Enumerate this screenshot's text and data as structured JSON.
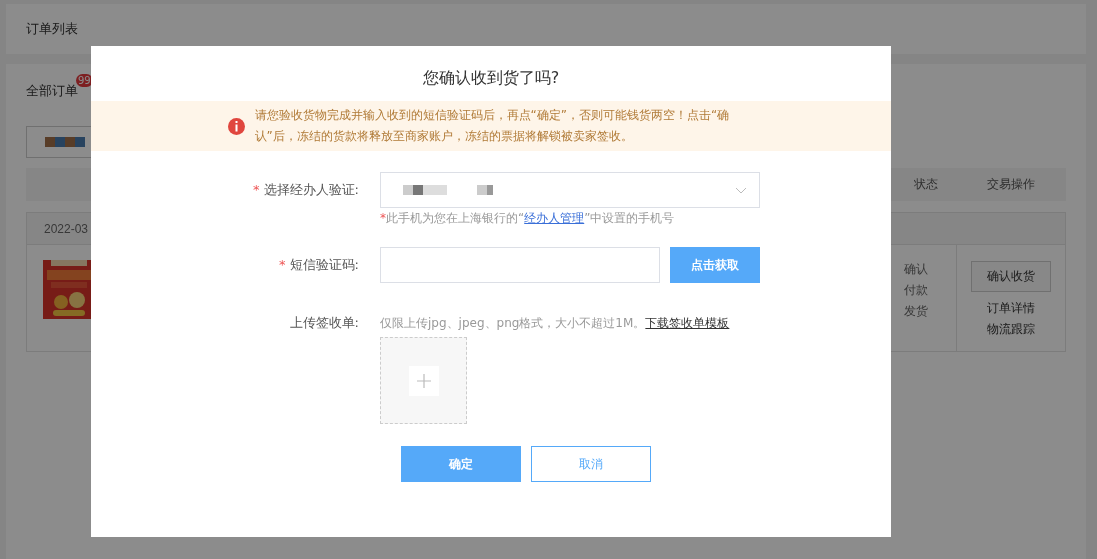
{
  "page": {
    "title": "订单列表",
    "tab_label": "全部订单",
    "tab_badge": "99",
    "table_columns": [
      "状态",
      "交易操作"
    ],
    "order": {
      "date": "2022-03",
      "statuses": [
        "确认",
        "付款",
        "发货"
      ],
      "confirm_button": "确认收货",
      "links": [
        "订单详情",
        "物流跟踪"
      ]
    }
  },
  "dialog": {
    "title": "您确认收到货了吗?",
    "alert": "请您验收货物完成并输入收到的短信验证码后，再点“确定”，否则可能钱货两空！点击“确认”后，冻结的货款将释放至商家账户，冻结的票据将解锁被卖家签收。",
    "fields": [
      {
        "kind": "select",
        "label": "选择经办人验证:",
        "required": true,
        "hint_mark": "*",
        "hint_before": "此手机为您在上海银行的“",
        "hint_link": "经办人管理",
        "hint_after": "”中设置的手机号"
      },
      {
        "kind": "code",
        "label": "短信验证码:",
        "required": true,
        "button": "点击获取"
      },
      {
        "kind": "upload",
        "label": "上传签收单:",
        "required": false,
        "hint": "仅限上传jpg、jpeg、png格式，大小不超过1M。",
        "hint_link": "下载签收单模板"
      }
    ],
    "buttons": [
      {
        "label": "确定",
        "kind": "primary"
      },
      {
        "label": "取消",
        "kind": "secondary"
      }
    ]
  }
}
